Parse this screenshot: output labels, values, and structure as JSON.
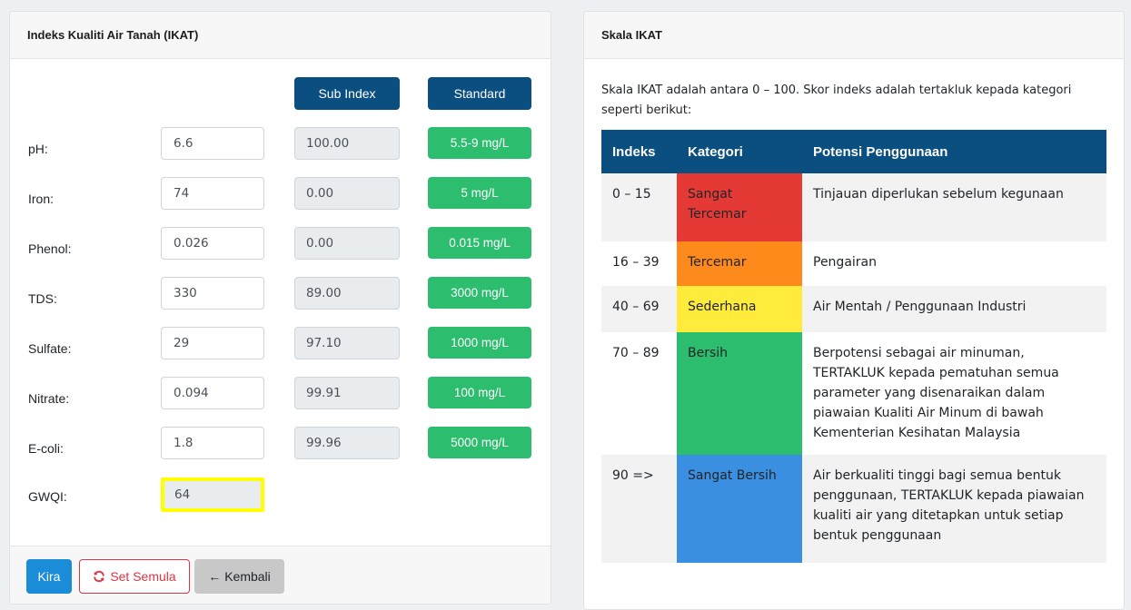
{
  "left_card": {
    "title": "Indeks Kualiti Air Tanah (IKAT)",
    "sub_index_label": "Sub Index",
    "standard_label": "Standard",
    "rows": [
      {
        "label": "pH:",
        "value": "6.6",
        "sub_index": "100.00",
        "standard": "5.5-9 mg/L"
      },
      {
        "label": "Iron:",
        "value": "74",
        "sub_index": "0.00",
        "standard": "5 mg/L"
      },
      {
        "label": "Phenol:",
        "value": "0.026",
        "sub_index": "0.00",
        "standard": "0.015 mg/L"
      },
      {
        "label": "TDS:",
        "value": "330",
        "sub_index": "89.00",
        "standard": "3000 mg/L"
      },
      {
        "label": "Sulfate:",
        "value": "29",
        "sub_index": "97.10",
        "standard": "1000 mg/L"
      },
      {
        "label": "Nitrate:",
        "value": "0.094",
        "sub_index": "99.91",
        "standard": "100 mg/L"
      },
      {
        "label": "E-coli:",
        "value": "1.8",
        "sub_index": "99.96",
        "standard": "5000 mg/L"
      }
    ],
    "gwqi_label": "GWQI:",
    "gwqi_value": "64",
    "footer": {
      "kira_label": "Kira",
      "reset_label": "Set Semula",
      "back_label": "Kembali",
      "reset_icon": "sync-icon",
      "back_icon": "arrow-left-icon"
    }
  },
  "right_card": {
    "title": "Skala IKAT",
    "intro": "Skala IKAT adalah antara 0 – 100. Skor indeks adalah tertakluk kepada kategori seperti berikut:",
    "headers": {
      "indeks": "Indeks",
      "kategori": "Kategori",
      "potensi": "Potensi Penggunaan"
    },
    "rows": [
      {
        "indeks": "0 – 15",
        "kategori": "Sangat Tercemar",
        "color": "#e53935",
        "potensi": "Tinjauan diperlukan sebelum kegunaan"
      },
      {
        "indeks": "16 – 39",
        "kategori": "Tercemar",
        "color": "#ff8a1c",
        "potensi": "Pengairan"
      },
      {
        "indeks": "40 – 69",
        "kategori": "Sederhana",
        "color": "#ffeb3b",
        "potensi": "Air Mentah / Penggunaan Industri"
      },
      {
        "indeks": "70 – 89",
        "kategori": "Bersih",
        "color": "#2dbd6e",
        "potensi": "Berpotensi sebagai air minuman, TERTAKLUK kepada pematuhan semua parameter yang disenaraikan dalam piawaian Kualiti Air Minum di bawah Kementerian Kesihatan Malaysia"
      },
      {
        "indeks": "90 =>",
        "kategori": "Sangat Bersih",
        "color": "#3a8fe0",
        "potensi": "Air berkualiti tinggi bagi semua bentuk penggunaan, TERTAKLUK kepada piawaian kualiti air yang ditetapkan untuk setiap bentuk penggunaan"
      }
    ]
  },
  "colors": {
    "header_blue": "#0b4f80",
    "standard_green": "#2dbd6e",
    "kira_blue": "#1a8cd8",
    "reset_red": "#dc3545",
    "highlight_yellow": "#ffff00"
  }
}
